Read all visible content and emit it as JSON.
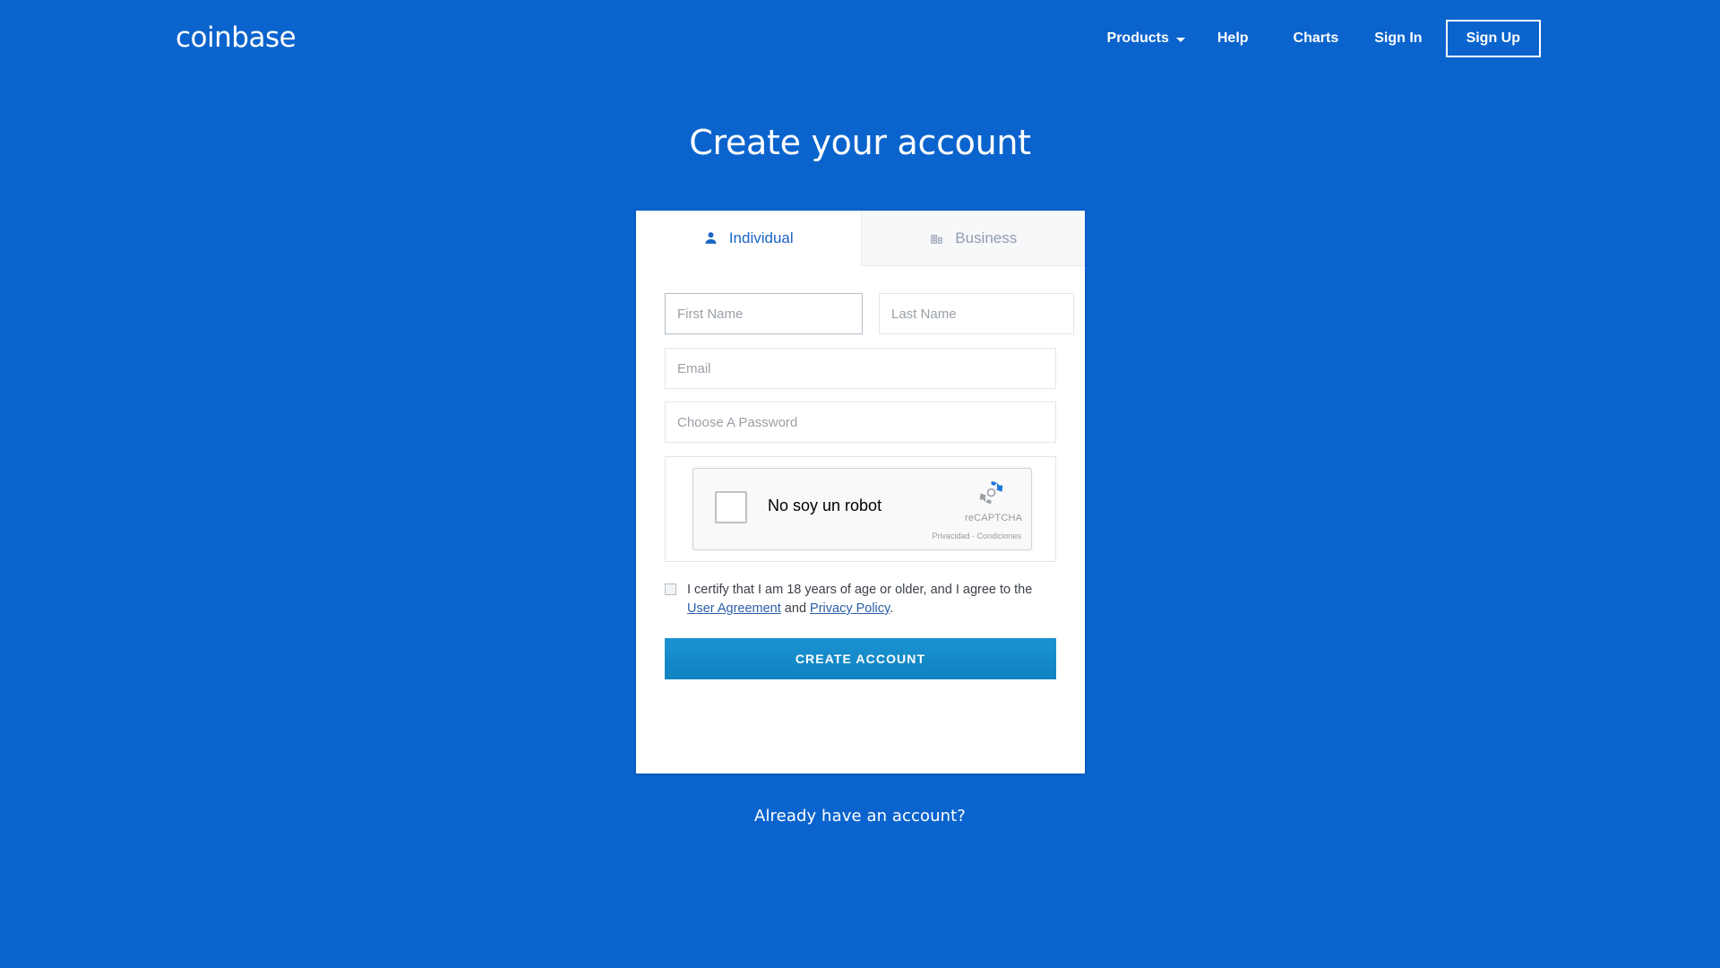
{
  "theme": {
    "background": "#0b64cd",
    "card_background": "#ffffff",
    "accent_blue": "#1a65c4",
    "submit_blue": "#1083c1",
    "link_blue": "#2c5ea8",
    "muted_text": "#9aa0a6"
  },
  "nav": {
    "brand": "coinbase",
    "products": "Products",
    "help": "Help",
    "charts": "Charts",
    "sign_in": "Sign In",
    "sign_up": "Sign Up"
  },
  "page": {
    "headline": "Create your account",
    "already_have_account": "Already have an account?"
  },
  "tabs": [
    {
      "label": "Individual",
      "icon": "person-icon",
      "active": true
    },
    {
      "label": "Business",
      "icon": "building-icon",
      "active": false
    }
  ],
  "form": {
    "first_name": {
      "placeholder": "First Name",
      "value": "",
      "focused": true
    },
    "last_name": {
      "placeholder": "Last Name",
      "value": ""
    },
    "email": {
      "placeholder": "Email",
      "value": ""
    },
    "password": {
      "placeholder": "Choose A Password",
      "value": ""
    },
    "submit_label": "CREATE ACCOUNT"
  },
  "captcha": {
    "label": "No soy un robot",
    "brand": "reCAPTCHA",
    "terms": "Privacidad - Condiciones",
    "checked": false
  },
  "certify": {
    "checked": false,
    "text_before": "I certify that I am 18 years of age or older, and I agree to the ",
    "user_agreement": "User Agreement",
    "conjunction": " and ",
    "privacy_policy": "Privacy Policy",
    "text_after": "."
  }
}
